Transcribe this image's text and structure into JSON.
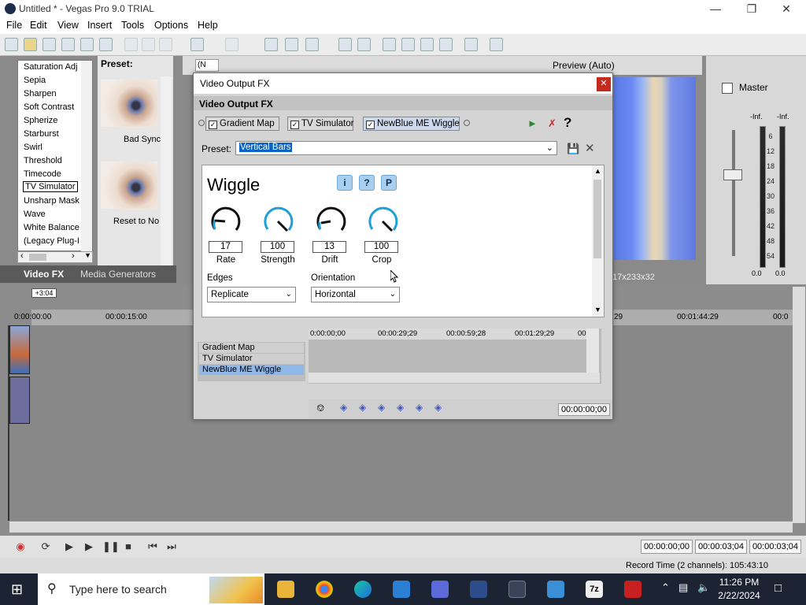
{
  "window": {
    "title": "Untitled * - Vegas Pro 9.0 TRIAL"
  },
  "menu": [
    "File",
    "Edit",
    "View",
    "Insert",
    "Tools",
    "Options",
    "Help"
  ],
  "fx_list": {
    "items": [
      "Saturation Adj",
      "Sepia",
      "Sharpen",
      "Soft Contrast",
      "Spherize",
      "Starburst",
      "Swirl",
      "Threshold",
      "Timecode",
      "TV Simulator",
      "Unsharp Mask",
      "Wave",
      "White Balance",
      "(Legacy Plug-I"
    ],
    "selected": "TV Simulator"
  },
  "preset_pane": {
    "header": "Preset:",
    "captions": [
      "Bad Sync",
      "Reset to No"
    ]
  },
  "docked_tabs": [
    "Video FX",
    "Media Generators"
  ],
  "preview": {
    "mode": "Preview (Auto)",
    "dimensions": "17x233x32"
  },
  "mixer": {
    "label": "Master",
    "left_peak": "-Inf.",
    "right_peak": "-Inf.",
    "ticks": [
      "6",
      "12",
      "18",
      "24",
      "30",
      "36",
      "42",
      "48",
      "54"
    ],
    "left_bottom": "0.0",
    "right_bottom": "0.0"
  },
  "timeline": {
    "offset": "+3:04",
    "ruler": [
      "0:00:00:00",
      "00:00:15:00",
      "29",
      "00:01:44:29",
      "00:0"
    ]
  },
  "transport": {
    "timecodes": [
      "00:00:00;00",
      "00:00:03;04",
      "00:00:03;04"
    ]
  },
  "status": {
    "record_time": "Record Time (2 channels): 105:43:10"
  },
  "dialog": {
    "title": "Video Output FX",
    "header": "Video Output FX",
    "chain": [
      "Gradient Map",
      "TV Simulator",
      "NewBlue ME Wiggle"
    ],
    "preset_label": "Preset:",
    "preset_value": "Vertical Bars",
    "plugin_title": "Wiggle",
    "buttons": [
      "i",
      "?",
      "P"
    ],
    "knobs": [
      {
        "label": "Rate",
        "value": "17"
      },
      {
        "label": "Strength",
        "value": "100"
      },
      {
        "label": "Drift",
        "value": "13"
      },
      {
        "label": "Crop",
        "value": "100"
      }
    ],
    "edges_label": "Edges",
    "edges_value": "Replicate",
    "orientation_label": "Orientation",
    "orientation_value": "Horizontal",
    "kf_tracks": [
      "Gradient Map",
      "TV Simulator",
      "NewBlue ME Wiggle"
    ],
    "kf_ruler": [
      "0:00:00;00",
      "00:00:29;29",
      "00:00:59;28",
      "00:01:29;29",
      "00"
    ],
    "kf_timecode": "00:00:00;00"
  },
  "taskbar": {
    "search_placeholder": "Type here to search",
    "time": "11:26 PM",
    "date": "2/22/2024"
  },
  "colors": {
    "accent": "#0a64c8",
    "close": "#c42b1c",
    "knob_blue": "#1e9fd8",
    "taskbar": "#1c2333"
  }
}
